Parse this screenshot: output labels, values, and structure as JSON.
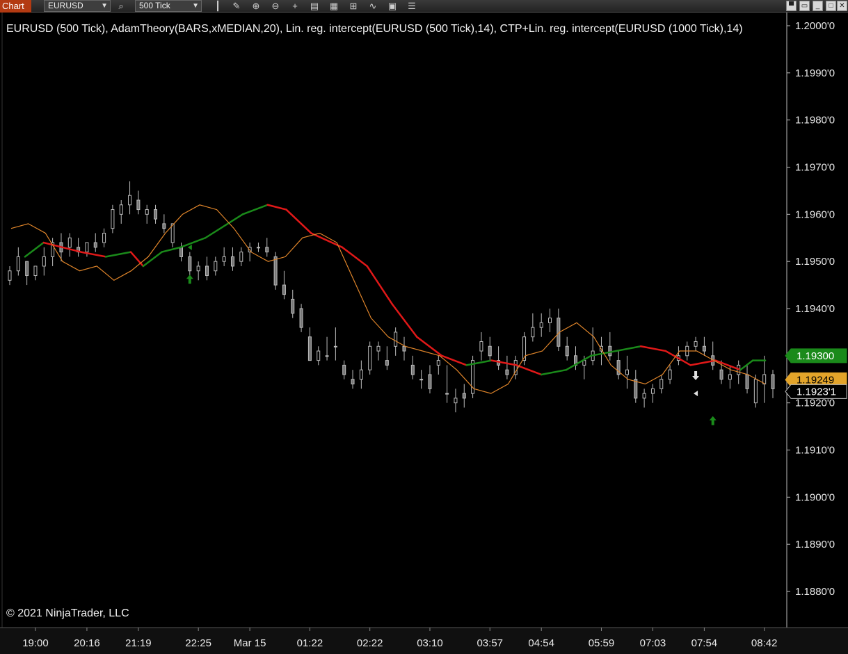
{
  "toolbar": {
    "tab_label": "Chart",
    "instrument": "EURUSD",
    "interval": "500 Tick",
    "icons": [
      "search-icon",
      "bar-style-icon",
      "draw-pencil-icon",
      "zoom-in-icon",
      "zoom-out-icon",
      "crosshair-icon",
      "data-box-icon",
      "properties-icon",
      "strategy-icon",
      "indicator-icon",
      "menu-icon"
    ]
  },
  "window_controls": [
    "tile-icon",
    "restore-icon",
    "minimize-icon",
    "maximize-icon",
    "close-icon"
  ],
  "copyright": "© 2021 NinjaTrader, LLC",
  "chart_data": {
    "type": "candlestick",
    "title": "EURUSD (500 Tick), AdamTheory(BARS,xMEDIAN,20), Lin. reg. intercept(EURUSD (500 Tick),14), CTP+Lin. reg. intercept(EURUSD (1000 Tick),14)",
    "ylim": [
      1.1872,
      1.2008
    ],
    "y_ticks": [
      {
        "v": 1.2,
        "label": "1.2000'0"
      },
      {
        "v": 1.199,
        "label": "1.1990'0"
      },
      {
        "v": 1.198,
        "label": "1.1980'0"
      },
      {
        "v": 1.197,
        "label": "1.1970'0"
      },
      {
        "v": 1.196,
        "label": "1.1960'0"
      },
      {
        "v": 1.195,
        "label": "1.1950'0"
      },
      {
        "v": 1.194,
        "label": "1.1940'0"
      },
      {
        "v": 1.193,
        "label": "1.1930'0"
      },
      {
        "v": 1.192,
        "label": "1.1920'0"
      },
      {
        "v": 1.191,
        "label": "1.1910'0"
      },
      {
        "v": 1.19,
        "label": "1.1900'0"
      },
      {
        "v": 1.189,
        "label": "1.1890'0"
      },
      {
        "v": 1.188,
        "label": "1.1880'0"
      }
    ],
    "x_ticks": [
      {
        "i": 3,
        "label": "19:00"
      },
      {
        "i": 9,
        "label": "20:16"
      },
      {
        "i": 15,
        "label": "21:19"
      },
      {
        "i": 22,
        "label": "22:25"
      },
      {
        "i": 28,
        "label": "Mar 15"
      },
      {
        "i": 35,
        "label": "01:22"
      },
      {
        "i": 42,
        "label": "02:22"
      },
      {
        "i": 49,
        "label": "03:10"
      },
      {
        "i": 56,
        "label": "03:57"
      },
      {
        "i": 62,
        "label": "04:54"
      },
      {
        "i": 69,
        "label": "05:59"
      },
      {
        "i": 75,
        "label": "07:03"
      },
      {
        "i": 81,
        "label": "07:54"
      },
      {
        "i": 88,
        "label": "08:42"
      }
    ],
    "x_range": [
      0,
      89
    ],
    "candles": [
      [
        1.1946,
        1.1949,
        1.1945,
        1.1948
      ],
      [
        1.1948,
        1.1953,
        1.1947,
        1.1951
      ],
      [
        1.195,
        1.195,
        1.1945,
        1.1947
      ],
      [
        1.1947,
        1.1949,
        1.1946,
        1.1949
      ],
      [
        1.1949,
        1.1953,
        1.1947,
        1.1951
      ],
      [
        1.1951,
        1.1955,
        1.1949,
        1.1954
      ],
      [
        1.1954,
        1.1956,
        1.195,
        1.1952
      ],
      [
        1.1953,
        1.1956,
        1.1951,
        1.1955
      ],
      [
        1.1953,
        1.1955,
        1.1951,
        1.1952
      ],
      [
        1.1952,
        1.1954,
        1.1951,
        1.1954
      ],
      [
        1.1954,
        1.1956,
        1.1952,
        1.1953
      ],
      [
        1.1954,
        1.1957,
        1.1953,
        1.1956
      ],
      [
        1.1957,
        1.1962,
        1.1956,
        1.1961
      ],
      [
        1.196,
        1.1963,
        1.1958,
        1.1962
      ],
      [
        1.1962,
        1.1967,
        1.196,
        1.1964
      ],
      [
        1.1963,
        1.1965,
        1.196,
        1.1961
      ],
      [
        1.196,
        1.1962,
        1.1958,
        1.1961
      ],
      [
        1.1961,
        1.1962,
        1.1958,
        1.1959
      ],
      [
        1.1958,
        1.196,
        1.1956,
        1.1957
      ],
      [
        1.1954,
        1.1958,
        1.1953,
        1.1958
      ],
      [
        1.1953,
        1.1954,
        1.195,
        1.1951
      ],
      [
        1.1951,
        1.1952,
        1.1947,
        1.1948
      ],
      [
        1.1948,
        1.195,
        1.1946,
        1.1949
      ],
      [
        1.1949,
        1.1951,
        1.1946,
        1.1947
      ],
      [
        1.1948,
        1.1951,
        1.1947,
        1.195
      ],
      [
        1.195,
        1.1953,
        1.1949,
        1.1951
      ],
      [
        1.1951,
        1.1953,
        1.1948,
        1.1949
      ],
      [
        1.195,
        1.1953,
        1.1949,
        1.1952
      ],
      [
        1.1952,
        1.1954,
        1.195,
        1.1953
      ],
      [
        1.1953,
        1.1954,
        1.1952,
        1.1953
      ],
      [
        1.1953,
        1.1955,
        1.1951,
        1.1952
      ],
      [
        1.1951,
        1.1952,
        1.1944,
        1.1945
      ],
      [
        1.1945,
        1.1948,
        1.1942,
        1.1943
      ],
      [
        1.1942,
        1.1944,
        1.1938,
        1.1939
      ],
      [
        1.194,
        1.1941,
        1.1935,
        1.1936
      ],
      [
        1.1934,
        1.1936,
        1.1929,
        1.1929
      ],
      [
        1.1929,
        1.1932,
        1.1928,
        1.1931
      ],
      [
        1.193,
        1.1934,
        1.1929,
        1.193
      ],
      [
        1.1932,
        1.1936,
        1.1929,
        1.1932
      ],
      [
        1.1928,
        1.1929,
        1.1925,
        1.1926
      ],
      [
        1.1925,
        1.1927,
        1.1923,
        1.1924
      ],
      [
        1.1925,
        1.1929,
        1.1923,
        1.1927
      ],
      [
        1.1927,
        1.1933,
        1.1926,
        1.1932
      ],
      [
        1.1931,
        1.1933,
        1.1929,
        1.1932
      ],
      [
        1.1929,
        1.1932,
        1.1927,
        1.1928
      ],
      [
        1.1932,
        1.1936,
        1.193,
        1.1935
      ],
      [
        1.1932,
        1.1934,
        1.1929,
        1.1931
      ],
      [
        1.1928,
        1.193,
        1.1925,
        1.1926
      ],
      [
        1.1925,
        1.1927,
        1.1923,
        1.1925
      ],
      [
        1.1926,
        1.1928,
        1.1922,
        1.1923
      ],
      [
        1.1928,
        1.193,
        1.1926,
        1.1929
      ],
      [
        1.1922,
        1.1928,
        1.192,
        1.1922
      ],
      [
        1.192,
        1.1923,
        1.1918,
        1.1921
      ],
      [
        1.1922,
        1.1924,
        1.1919,
        1.1921
      ],
      [
        1.1922,
        1.193,
        1.1921,
        1.1929
      ],
      [
        1.1931,
        1.1935,
        1.1929,
        1.1933
      ],
      [
        1.1932,
        1.1934,
        1.1929,
        1.193
      ],
      [
        1.1929,
        1.1932,
        1.1927,
        1.1928
      ],
      [
        1.1927,
        1.193,
        1.1925,
        1.1926
      ],
      [
        1.1926,
        1.193,
        1.1925,
        1.1929
      ],
      [
        1.1929,
        1.1935,
        1.1928,
        1.1934
      ],
      [
        1.1934,
        1.1939,
        1.1933,
        1.1936
      ],
      [
        1.1936,
        1.1939,
        1.1934,
        1.1937
      ],
      [
        1.1937,
        1.194,
        1.1935,
        1.1938
      ],
      [
        1.1938,
        1.194,
        1.1931,
        1.1932
      ],
      [
        1.1932,
        1.1934,
        1.1929,
        1.193
      ],
      [
        1.193,
        1.1932,
        1.1927,
        1.1928
      ],
      [
        1.1928,
        1.193,
        1.1925,
        1.1929
      ],
      [
        1.1929,
        1.1936,
        1.1928,
        1.1931
      ],
      [
        1.1931,
        1.1934,
        1.1928,
        1.1932
      ],
      [
        1.1932,
        1.1935,
        1.1929,
        1.193
      ],
      [
        1.1929,
        1.1931,
        1.1925,
        1.1926
      ],
      [
        1.1926,
        1.193,
        1.1923,
        1.1927
      ],
      [
        1.1925,
        1.1927,
        1.192,
        1.1921
      ],
      [
        1.1921,
        1.1923,
        1.1919,
        1.1922
      ],
      [
        1.1922,
        1.1924,
        1.192,
        1.1923
      ],
      [
        1.1923,
        1.1926,
        1.1922,
        1.1925
      ],
      [
        1.1925,
        1.1928,
        1.1924,
        1.1927
      ],
      [
        1.1929,
        1.1932,
        1.1928,
        1.193
      ],
      [
        1.193,
        1.1933,
        1.1929,
        1.1932
      ],
      [
        1.1932,
        1.1934,
        1.1931,
        1.1933
      ],
      [
        1.1932,
        1.1934,
        1.193,
        1.1931
      ],
      [
        1.193,
        1.1933,
        1.1927,
        1.1928
      ],
      [
        1.1927,
        1.1929,
        1.1924,
        1.1925
      ],
      [
        1.1925,
        1.1928,
        1.1923,
        1.1926
      ],
      [
        1.1926,
        1.1929,
        1.1924,
        1.1928
      ],
      [
        1.1926,
        1.1928,
        1.1922,
        1.1923
      ],
      [
        1.192,
        1.1926,
        1.1919,
        1.1925
      ],
      [
        1.1924,
        1.193,
        1.192,
        1.1926
      ],
      [
        1.1926,
        1.1927,
        1.1921,
        1.1923
      ]
    ],
    "series": [
      {
        "indicator": "AdamTheory(BARS,xMEDIAN,20)",
        "color_up": "#1a8a1a",
        "color_down": "#e01818",
        "points": [
          [
            1,
            1.1951,
            "g"
          ],
          [
            4,
            1.1954,
            "g"
          ],
          [
            10,
            1.1952,
            "r"
          ],
          [
            14,
            1.1951,
            "r"
          ],
          [
            18,
            1.1952,
            "g"
          ],
          [
            20,
            1.1949,
            "r"
          ],
          [
            23,
            1.1952,
            "g"
          ],
          [
            26,
            1.1953,
            "g"
          ],
          [
            30,
            1.1955,
            "g"
          ],
          [
            36,
            1.196,
            "g"
          ],
          [
            40,
            1.1962,
            "g"
          ],
          [
            43,
            1.1961,
            "r"
          ],
          [
            47,
            1.1956,
            "r"
          ],
          [
            52,
            1.1953,
            "r"
          ],
          [
            56,
            1.1949,
            "r"
          ],
          [
            60,
            1.1941,
            "r"
          ],
          [
            64,
            1.1934,
            "r"
          ],
          [
            68,
            1.193,
            "r"
          ],
          [
            72,
            1.1928,
            "r"
          ],
          [
            76,
            1.1929,
            "g"
          ],
          [
            80,
            1.1928,
            "r"
          ],
          [
            84,
            1.1926,
            "r"
          ],
          [
            88,
            1.1927,
            "g"
          ],
          [
            92,
            1.193,
            "g"
          ],
          [
            96,
            1.1931,
            "g"
          ],
          [
            100,
            1.1932,
            "g"
          ],
          [
            104,
            1.1931,
            "r"
          ],
          [
            108,
            1.1928,
            "r"
          ],
          [
            112,
            1.1929,
            "r"
          ],
          [
            116,
            1.1927,
            "r"
          ],
          [
            118,
            1.1929,
            "g"
          ],
          [
            120,
            1.1929,
            "g"
          ]
        ]
      },
      {
        "indicator": "Lin. reg. intercept(EURUSD (500 Tick),14)",
        "color": "#e0852a",
        "points": [
          [
            0,
            1.1957
          ],
          [
            2,
            1.1958
          ],
          [
            4,
            1.1956
          ],
          [
            6,
            1.195
          ],
          [
            8,
            1.1948
          ],
          [
            10,
            1.1949
          ],
          [
            12,
            1.1946
          ],
          [
            14,
            1.1948
          ],
          [
            16,
            1.1951
          ],
          [
            18,
            1.1956
          ],
          [
            20,
            1.196
          ],
          [
            22,
            1.1962
          ],
          [
            24,
            1.1961
          ],
          [
            26,
            1.1957
          ],
          [
            28,
            1.1952
          ],
          [
            30,
            1.195
          ],
          [
            32,
            1.1951
          ],
          [
            34,
            1.1955
          ],
          [
            36,
            1.1956
          ],
          [
            38,
            1.1954
          ],
          [
            40,
            1.1946
          ],
          [
            42,
            1.1938
          ],
          [
            44,
            1.1934
          ],
          [
            46,
            1.1932
          ],
          [
            48,
            1.1931
          ],
          [
            50,
            1.193
          ],
          [
            52,
            1.1927
          ],
          [
            54,
            1.1923
          ],
          [
            56,
            1.1922
          ],
          [
            58,
            1.1924
          ],
          [
            60,
            1.193
          ],
          [
            62,
            1.1931
          ],
          [
            64,
            1.1935
          ],
          [
            66,
            1.1937
          ],
          [
            68,
            1.1934
          ],
          [
            70,
            1.1928
          ],
          [
            72,
            1.1925
          ],
          [
            74,
            1.1924
          ],
          [
            76,
            1.1926
          ],
          [
            78,
            1.1931
          ],
          [
            80,
            1.1931
          ],
          [
            82,
            1.1929
          ],
          [
            84,
            1.1927
          ],
          [
            86,
            1.1926
          ],
          [
            88,
            1.1924
          ]
        ]
      }
    ],
    "markers": [
      {
        "i": 21,
        "v": 1.1946,
        "kind": "up-arrow",
        "color": "#1a8a1a"
      },
      {
        "i": 82,
        "v": 1.1916,
        "kind": "up-arrow",
        "color": "#1a8a1a"
      },
      {
        "i": 80,
        "v": 1.1926,
        "kind": "down-arrow",
        "color": "#e0e0e0"
      },
      {
        "i": 21,
        "v": 1.1953,
        "kind": "tiny-triangle",
        "color": "#1a8a1a"
      },
      {
        "i": 80,
        "v": 1.1922,
        "kind": "tiny-triangle",
        "color": "#e0e0e0"
      }
    ],
    "price_labels": [
      {
        "v": 1.193,
        "label": "1.19300",
        "bg": "#1a8a1a",
        "fg": "#ffffff"
      },
      {
        "v": 1.19249,
        "label": "1.19249",
        "bg": "#e3a42a",
        "fg": "#000000"
      },
      {
        "v": 1.1923,
        "label": "1.1923'1",
        "bg": "#000000",
        "fg": "#ffffff"
      }
    ],
    "grid": false
  }
}
